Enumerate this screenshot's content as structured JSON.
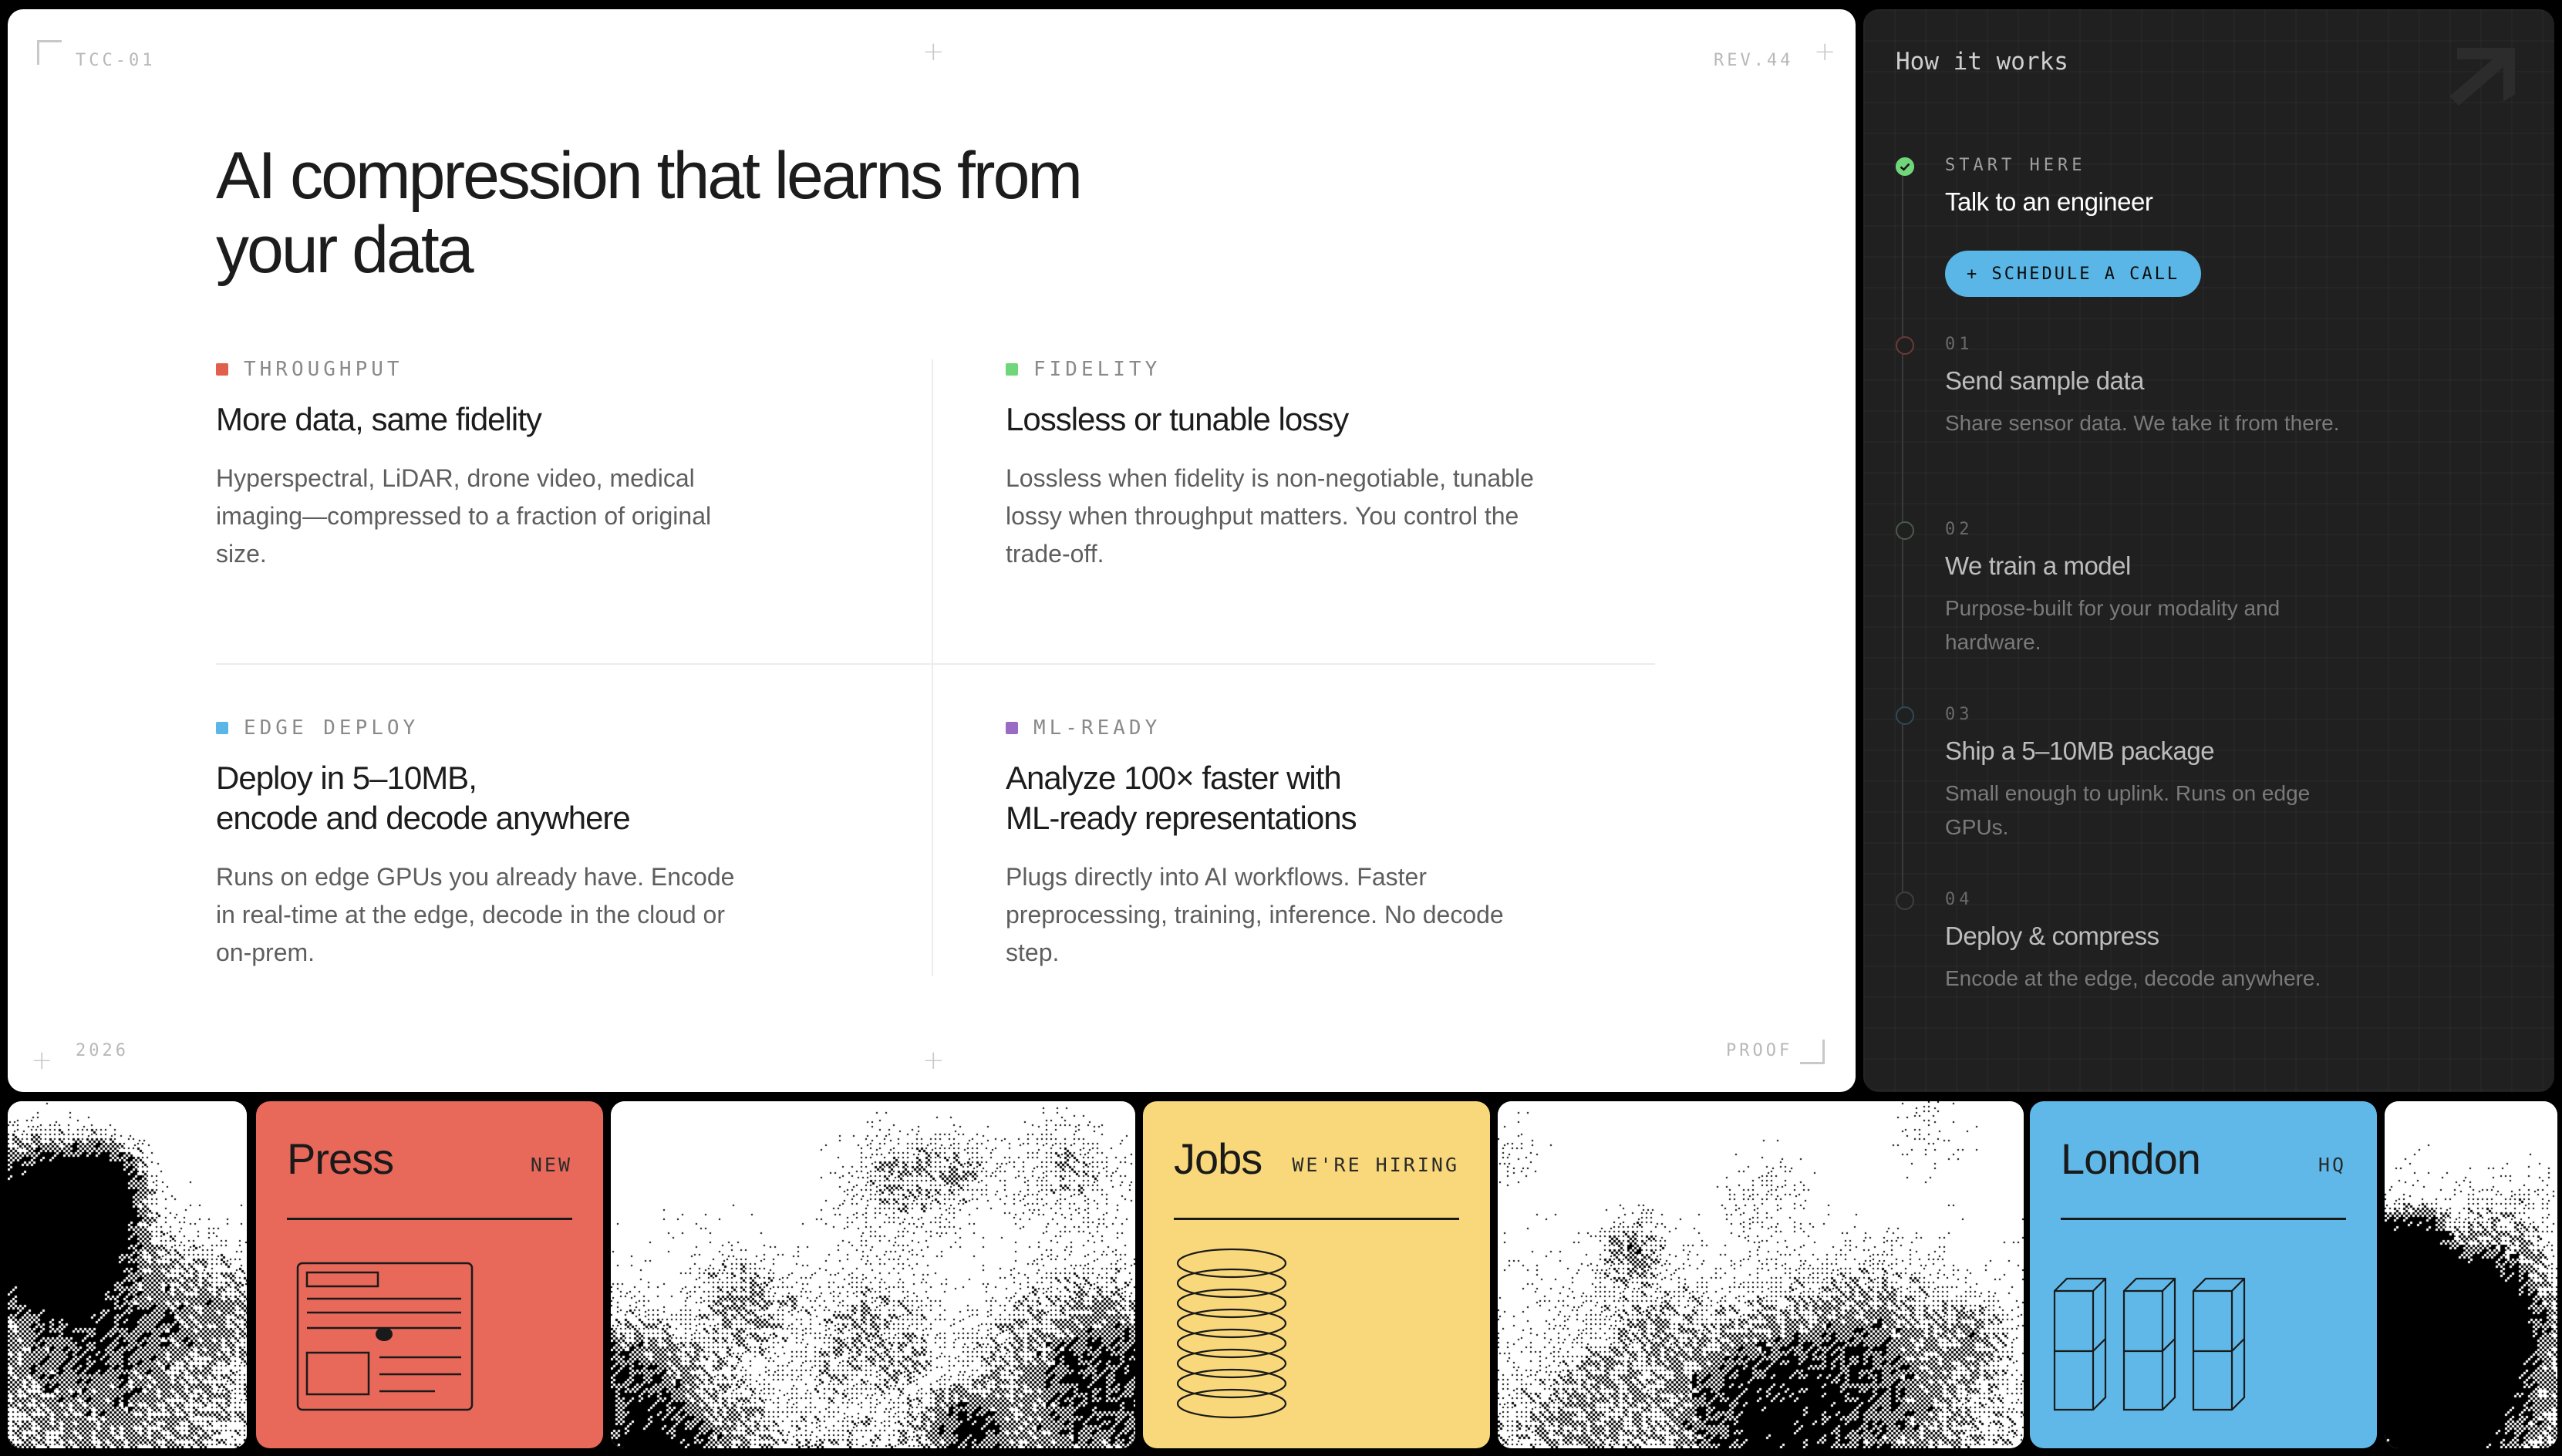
{
  "main": {
    "corner_top_left": "TCC-01",
    "corner_top_right": "REV.44",
    "corner_bottom_left": "2026",
    "corner_bottom_right": "PROOF",
    "hero_title": "AI compression that learns from your data",
    "features": [
      {
        "tag": "THROUGHPUT",
        "tag_color": "#e0604d",
        "title": "More data, same fidelity",
        "body": "Hyperspectral, LiDAR, drone video, medical imaging—compressed to a fraction of original size."
      },
      {
        "tag": "FIDELITY",
        "tag_color": "#6fd67a",
        "title": "Lossless or tunable lossy",
        "body": "Lossless when fidelity is non-negotiable, tunable lossy when throughput matters. You control the trade-off."
      },
      {
        "tag": "EDGE DEPLOY",
        "tag_color": "#5ab6e6",
        "title": "Deploy in 5–10MB,\nencode and decode anywhere",
        "body": "Runs on edge GPUs you already have. Encode in real-time at the edge, decode in the cloud or on-prem."
      },
      {
        "tag": "ML-READY",
        "tag_color": "#9a6bc4",
        "title": "Analyze 100× faster with\nML-ready representations",
        "body": "Plugs directly into AI workflows. Faster preprocessing, training, inference. No decode step."
      }
    ]
  },
  "panel": {
    "title": "How it works",
    "steps": [
      {
        "num": "START HERE",
        "title": "Talk to an engineer",
        "desc": "",
        "cta": "+ SCHEDULE A CALL",
        "status": "done"
      },
      {
        "num": "01",
        "title": "Send sample data",
        "desc": "Share sensor data. We take it from there.",
        "status": "pending"
      },
      {
        "num": "02",
        "title": "We train a model",
        "desc": "Purpose-built for your modality and hardware.",
        "status": "pending"
      },
      {
        "num": "03",
        "title": "Ship a 5–10MB package",
        "desc": "Small enough to uplink. Runs on edge GPUs.",
        "status": "pending"
      },
      {
        "num": "04",
        "title": "Deploy & compress",
        "desc": "Encode at the edge, decode anywhere.",
        "status": "pending"
      }
    ]
  },
  "tiles": {
    "press": {
      "name": "Press",
      "badge": "NEW",
      "color": "#e8685a",
      "icon": "newspaper-icon"
    },
    "jobs": {
      "name": "Jobs",
      "badge": "WE'RE HIRING",
      "color": "#f8d87a",
      "icon": "coil-spring-icon"
    },
    "london": {
      "name": "London",
      "badge": "HQ",
      "color": "#5fb8e8",
      "icon": "server-racks-icon"
    }
  }
}
